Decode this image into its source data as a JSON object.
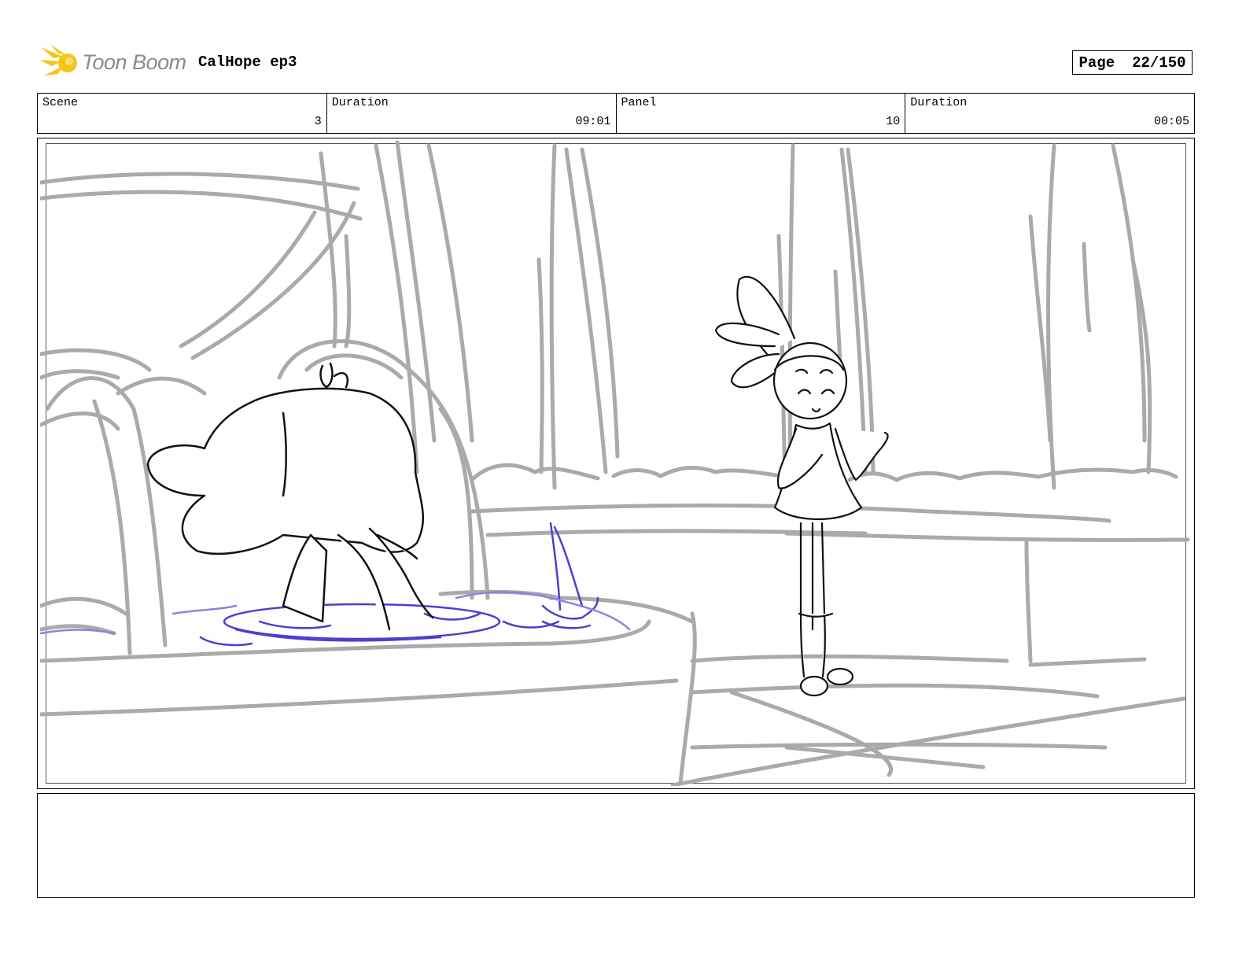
{
  "header": {
    "brand": "Toon Boom",
    "project_title": "CalHope ep3",
    "page_label": "Page",
    "page_value": "22/150"
  },
  "info": {
    "scene_label": "Scene",
    "scene_value": "3",
    "scene_duration_label": "Duration",
    "scene_duration_value": "09:01",
    "panel_label": "Panel",
    "panel_value": "10",
    "panel_duration_label": "Duration",
    "panel_duration_value": "00:05"
  },
  "caption": {
    "text": ""
  },
  "colors": {
    "background_lines": "#aaaaaa",
    "character_lines": "#111111",
    "water_lines": "#4a3fd0",
    "logo_flame": "#f5c518"
  },
  "icons": {
    "logo": "toon-boom-flame-logo"
  }
}
